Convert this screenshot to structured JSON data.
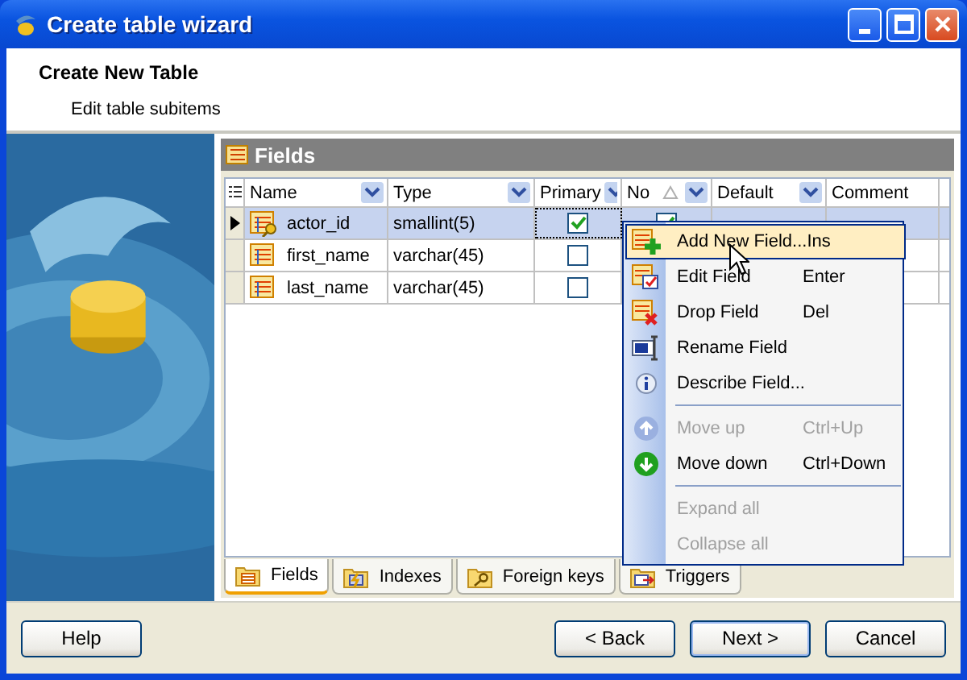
{
  "window": {
    "title": "Create table wizard"
  },
  "header": {
    "title": "Create New Table",
    "subtitle": "Edit table subitems"
  },
  "panel": {
    "title": "Fields"
  },
  "table": {
    "columns": [
      {
        "label": "Name",
        "dropdown": true,
        "sort": false
      },
      {
        "label": "Type",
        "dropdown": true,
        "sort": false
      },
      {
        "label": "Primary",
        "dropdown": true,
        "sort": false
      },
      {
        "label": "No",
        "dropdown": true,
        "sort": true
      },
      {
        "label": "Default",
        "dropdown": true,
        "sort": false
      },
      {
        "label": "Comment",
        "dropdown": false,
        "sort": false
      }
    ],
    "rows": [
      {
        "name": "actor_id",
        "type": "smallint(5)",
        "primary": true,
        "not_null": true,
        "selected": true,
        "key": true
      },
      {
        "name": "first_name",
        "type": "varchar(45)",
        "primary": false,
        "selected": false,
        "key": false
      },
      {
        "name": "last_name",
        "type": "varchar(45)",
        "primary": false,
        "selected": false,
        "key": false
      }
    ]
  },
  "context_menu": [
    {
      "kind": "item",
      "label": "Add New Field...",
      "shortcut": "Ins",
      "disabled": false,
      "selected": true
    },
    {
      "kind": "item",
      "label": "Edit Field",
      "shortcut": "Enter",
      "disabled": false,
      "selected": false
    },
    {
      "kind": "item",
      "label": "Drop Field",
      "shortcut": "Del",
      "disabled": false,
      "selected": false
    },
    {
      "kind": "item",
      "label": "Rename Field",
      "disabled": false,
      "selected": false
    },
    {
      "kind": "item",
      "label": "Describe Field...",
      "disabled": false,
      "selected": false
    },
    {
      "kind": "separator"
    },
    {
      "kind": "item",
      "label": "Move up",
      "shortcut": "Ctrl+Up",
      "disabled": true,
      "selected": false
    },
    {
      "kind": "item",
      "label": "Move down",
      "shortcut": "Ctrl+Down",
      "disabled": false,
      "selected": false
    },
    {
      "kind": "separator"
    },
    {
      "kind": "item",
      "label": "Expand all",
      "disabled": true,
      "selected": false
    },
    {
      "kind": "item",
      "label": "Collapse all",
      "disabled": true,
      "selected": false
    }
  ],
  "tabs": [
    {
      "label": "Fields",
      "selected": true
    },
    {
      "label": "Indexes",
      "selected": false
    },
    {
      "label": "Foreign keys",
      "selected": false
    },
    {
      "label": "Triggers",
      "selected": false
    }
  ],
  "buttons": {
    "left": [
      "Help"
    ],
    "right": [
      {
        "label": "< Back",
        "default": false
      },
      {
        "label": "Next >",
        "default": true
      },
      {
        "label": "Cancel",
        "default": false
      }
    ]
  }
}
